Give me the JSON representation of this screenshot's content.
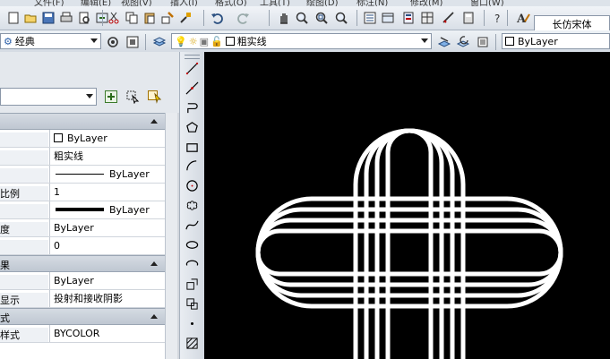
{
  "menu": [
    "文件(F)",
    "编辑(E)",
    "视图(V)",
    "插入(I)",
    "格式(O)",
    "工具(T)",
    "绘图(D)",
    "标注(N)",
    "修改(M)",
    "窗口(W)"
  ],
  "toolbar": {
    "text_style": "长仿宋体",
    "workspace": "经典",
    "layer": "粗实线",
    "color_control": "ByLayer"
  },
  "properties": {
    "sections": [
      {
        "title": "",
        "rows": [
          {
            "label": "",
            "value": "ByLayer",
            "kind": "color"
          },
          {
            "label": "",
            "value": "粗实线",
            "kind": "text"
          },
          {
            "label": "",
            "value": "ByLayer",
            "kind": "linetype"
          },
          {
            "label": "比例",
            "value": "1",
            "kind": "text"
          },
          {
            "label": "",
            "value": "ByLayer",
            "kind": "lineweight"
          },
          {
            "label": "度",
            "value": "ByLayer",
            "kind": "text"
          },
          {
            "label": "",
            "value": "0",
            "kind": "text"
          }
        ]
      },
      {
        "title": "果",
        "rows": [
          {
            "label": "",
            "value": "ByLayer",
            "kind": "text"
          },
          {
            "label": "显示",
            "value": "投射和接收阴影",
            "kind": "text"
          }
        ]
      },
      {
        "title": "式",
        "rows": [
          {
            "label": "样式",
            "value": "BYCOLOR",
            "kind": "text"
          }
        ]
      }
    ]
  },
  "icons": {
    "toolbar1": [
      "new-icon",
      "open-icon",
      "save-icon",
      "print-icon",
      "preview-icon",
      "publish-icon",
      "cut-icon",
      "copy-icon",
      "paste-icon",
      "match-icon",
      "brush-icon",
      "undo-icon",
      "redo-icon",
      "pan-icon",
      "zoom-realtime-icon",
      "zoom-window-icon",
      "zoom-previous-icon",
      "properties-icon",
      "designcenter-icon",
      "toolpalettes-icon",
      "sheetset-icon",
      "markup-icon",
      "calculator-icon",
      "help-icon",
      "text-style-icon"
    ],
    "draw": [
      "line-icon",
      "construction-line-icon",
      "polyline-icon",
      "polygon-icon",
      "rectangle-icon",
      "arc-icon",
      "circle-icon",
      "revcloud-icon",
      "spline-icon",
      "ellipse-icon",
      "ellipse-arc-icon",
      "insert-block-icon",
      "make-block-icon",
      "point-icon",
      "hatch-icon"
    ]
  },
  "colors": {
    "canvas": "#000000",
    "drawing": "#ffffff"
  }
}
